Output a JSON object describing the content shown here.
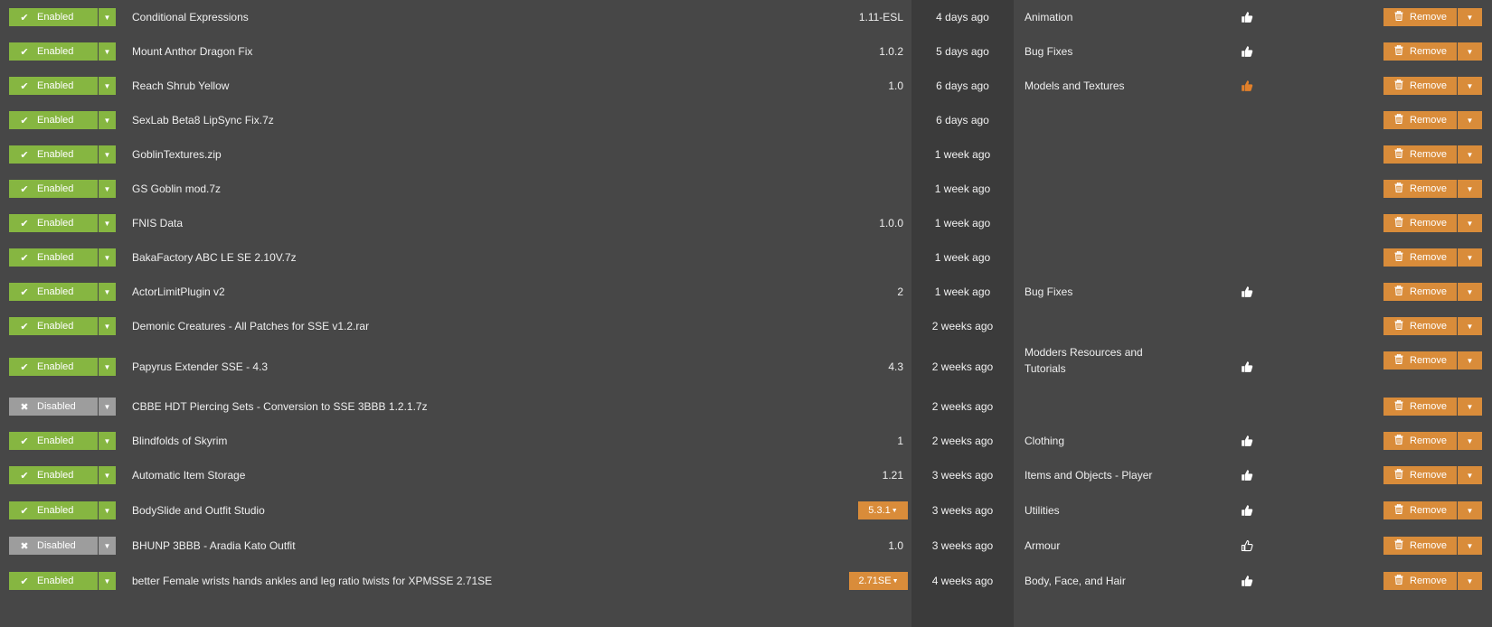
{
  "colors": {
    "enabled": "#86b641",
    "disabled": "#9d9d9d",
    "accent_orange": "#d98c3a",
    "background": "#474747",
    "date_column": "#3b3b3b",
    "endorsed_thumb": "#e2802a"
  },
  "labels": {
    "remove": "Remove"
  },
  "rows": [
    {
      "status": "Enabled",
      "enabled": true,
      "name": "Conditional Expressions",
      "version": "1.11-ESL",
      "version_dropdown": false,
      "date": "4 days ago",
      "category": "Animation",
      "thumb": "thumbs-up-icon"
    },
    {
      "status": "Enabled",
      "enabled": true,
      "name": "Mount Anthor Dragon Fix",
      "version": "1.0.2",
      "version_dropdown": false,
      "date": "5 days ago",
      "category": "Bug Fixes",
      "thumb": "thumbs-up-icon"
    },
    {
      "status": "Enabled",
      "enabled": true,
      "name": "Reach Shrub Yellow",
      "version": "1.0",
      "version_dropdown": false,
      "date": "6 days ago",
      "category": "Models and Textures",
      "thumb": "thumbs-up-endorsed-icon"
    },
    {
      "status": "Enabled",
      "enabled": true,
      "name": "SexLab Beta8 LipSync Fix.7z",
      "version": "",
      "version_dropdown": false,
      "date": "6 days ago",
      "category": "",
      "thumb": ""
    },
    {
      "status": "Enabled",
      "enabled": true,
      "name": "GoblinTextures.zip",
      "version": "",
      "version_dropdown": false,
      "date": "1 week ago",
      "category": "",
      "thumb": ""
    },
    {
      "status": "Enabled",
      "enabled": true,
      "name": "GS Goblin mod.7z",
      "version": "",
      "version_dropdown": false,
      "date": "1 week ago",
      "category": "",
      "thumb": ""
    },
    {
      "status": "Enabled",
      "enabled": true,
      "name": "FNIS Data",
      "version": "1.0.0",
      "version_dropdown": false,
      "date": "1 week ago",
      "category": "",
      "thumb": ""
    },
    {
      "status": "Enabled",
      "enabled": true,
      "name": "BakaFactory ABC LE SE 2.10V.7z",
      "version": "",
      "version_dropdown": false,
      "date": "1 week ago",
      "category": "",
      "thumb": ""
    },
    {
      "status": "Enabled",
      "enabled": true,
      "name": "ActorLimitPlugin v2",
      "version": "2",
      "version_dropdown": false,
      "date": "1 week ago",
      "category": "Bug Fixes",
      "thumb": "thumbs-up-icon"
    },
    {
      "status": "Enabled",
      "enabled": true,
      "name": "Demonic Creatures - All Patches for SSE v1.2.rar",
      "version": "",
      "version_dropdown": false,
      "date": "2 weeks ago",
      "category": "",
      "thumb": ""
    },
    {
      "status": "Enabled",
      "enabled": true,
      "name": "Papyrus Extender SSE - 4.3",
      "version": "4.3",
      "version_dropdown": false,
      "date": "2 weeks ago",
      "category": "Modders Resources and Tutorials",
      "thumb": "thumbs-up-icon"
    },
    {
      "status": "Disabled",
      "enabled": false,
      "name": "CBBE HDT Piercing Sets - Conversion to SSE 3BBB 1.2.1.7z",
      "version": "",
      "version_dropdown": false,
      "date": "2 weeks ago",
      "category": "",
      "thumb": ""
    },
    {
      "status": "Enabled",
      "enabled": true,
      "name": "Blindfolds of Skyrim",
      "version": "1",
      "version_dropdown": false,
      "date": "2 weeks ago",
      "category": "Clothing",
      "thumb": "thumbs-up-icon"
    },
    {
      "status": "Enabled",
      "enabled": true,
      "name": "Automatic Item Storage",
      "version": "1.21",
      "version_dropdown": false,
      "date": "3 weeks ago",
      "category": "Items and Objects - Player",
      "thumb": "thumbs-up-icon"
    },
    {
      "status": "Enabled",
      "enabled": true,
      "name": "BodySlide and Outfit Studio",
      "version": "5.3.1",
      "version_dropdown": true,
      "date": "3 weeks ago",
      "category": "Utilities",
      "thumb": "thumbs-up-icon"
    },
    {
      "status": "Disabled",
      "enabled": false,
      "name": "BHUNP 3BBB - Aradia Kato Outfit",
      "version": "1.0",
      "version_dropdown": false,
      "date": "3 weeks ago",
      "category": "Armour",
      "thumb": "thumbs-up-outline-icon"
    },
    {
      "status": "Enabled",
      "enabled": true,
      "name": "better Female wrists hands ankles and leg ratio twists for XPMSSE 2.71SE",
      "version": "2.71SE",
      "version_dropdown": true,
      "date": "4 weeks ago",
      "category": "Body, Face, and Hair",
      "thumb": "thumbs-up-icon"
    }
  ]
}
